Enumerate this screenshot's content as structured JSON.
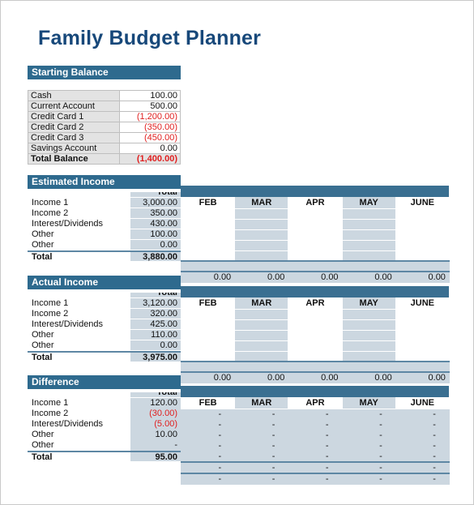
{
  "document": {
    "title": "Family Budget Planner"
  },
  "months": [
    "FEB",
    "MAR",
    "APR",
    "MAY",
    "JUNE"
  ],
  "starting_balance": {
    "heading": "Starting Balance",
    "rows": [
      {
        "label": "Cash",
        "value": "100.00",
        "negative": false
      },
      {
        "label": "Current Account",
        "value": "500.00",
        "negative": false
      },
      {
        "label": "Credit Card 1",
        "value": "(1,200.00)",
        "negative": true
      },
      {
        "label": "Credit Card 2",
        "value": "(350.00)",
        "negative": true
      },
      {
        "label": "Credit Card 3",
        "value": "(450.00)",
        "negative": true
      },
      {
        "label": "Savings Account",
        "value": "0.00",
        "negative": false
      }
    ],
    "total": {
      "label": "Total Balance",
      "value": "(1,400.00)",
      "negative": true
    }
  },
  "estimated_income": {
    "heading": "Estimated Income",
    "total_column_caption": "Total",
    "rows": [
      {
        "label": "Income 1",
        "total": "3,000.00",
        "negative": false,
        "months": [
          "",
          "",
          "",
          "",
          ""
        ]
      },
      {
        "label": "Income 2",
        "total": "350.00",
        "negative": false,
        "months": [
          "",
          "",
          "",
          "",
          ""
        ]
      },
      {
        "label": "Interest/Dividends",
        "total": "430.00",
        "negative": false,
        "months": [
          "",
          "",
          "",
          "",
          ""
        ]
      },
      {
        "label": "Other",
        "total": "100.00",
        "negative": false,
        "months": [
          "",
          "",
          "",
          "",
          ""
        ]
      },
      {
        "label": "Other",
        "total": "0.00",
        "negative": false,
        "months": [
          "",
          "",
          "",
          "",
          ""
        ]
      }
    ],
    "total_row": {
      "label": "Total",
      "total": "3,880.00",
      "negative": false,
      "months": [
        "",
        "",
        "",
        "",
        ""
      ]
    },
    "grand_row": {
      "months": [
        "0.00",
        "0.00",
        "0.00",
        "0.00",
        "0.00"
      ]
    }
  },
  "actual_income": {
    "heading": "Actual Income",
    "total_column_caption": "Total",
    "rows": [
      {
        "label": "Income 1",
        "total": "3,120.00",
        "negative": false,
        "months": [
          "",
          "",
          "",
          "",
          ""
        ]
      },
      {
        "label": "Income 2",
        "total": "320.00",
        "negative": false,
        "months": [
          "",
          "",
          "",
          "",
          ""
        ]
      },
      {
        "label": "Interest/Dividends",
        "total": "425.00",
        "negative": false,
        "months": [
          "",
          "",
          "",
          "",
          ""
        ]
      },
      {
        "label": "Other",
        "total": "110.00",
        "negative": false,
        "months": [
          "",
          "",
          "",
          "",
          ""
        ]
      },
      {
        "label": "Other",
        "total": "0.00",
        "negative": false,
        "months": [
          "",
          "",
          "",
          "",
          ""
        ]
      }
    ],
    "total_row": {
      "label": "Total",
      "total": "3,975.00",
      "negative": false,
      "months": [
        "",
        "",
        "",
        "",
        ""
      ]
    },
    "grand_row": {
      "months": [
        "0.00",
        "0.00",
        "0.00",
        "0.00",
        "0.00"
      ]
    }
  },
  "difference": {
    "heading": "Difference",
    "total_column_caption": "Total",
    "rows": [
      {
        "label": "Income 1",
        "total": "120.00",
        "negative": false,
        "months": [
          "-",
          "-",
          "-",
          "-",
          "-"
        ]
      },
      {
        "label": "Income 2",
        "total": "(30.00)",
        "negative": true,
        "months": [
          "-",
          "-",
          "-",
          "-",
          "-"
        ]
      },
      {
        "label": "Interest/Dividends",
        "total": "(5.00)",
        "negative": true,
        "months": [
          "-",
          "-",
          "-",
          "-",
          "-"
        ]
      },
      {
        "label": "Other",
        "total": "10.00",
        "negative": false,
        "months": [
          "-",
          "-",
          "-",
          "-",
          "-"
        ]
      },
      {
        "label": "Other",
        "total": "-",
        "negative": false,
        "months": [
          "-",
          "-",
          "-",
          "-",
          "-"
        ]
      }
    ],
    "total_row": {
      "label": "Total",
      "total": "95.00",
      "negative": false,
      "months": [
        "-",
        "-",
        "-",
        "-",
        "-"
      ]
    },
    "grand_row": {
      "months": [
        "-",
        "-",
        "-",
        "-",
        "-"
      ]
    }
  },
  "colors": {
    "title": "#17487a",
    "section_header_bg": "#2e6a8e",
    "month_bar_bg": "#3a6f91",
    "stripe_bg": "#ccd7e0",
    "negative_text": "#e02020",
    "rule": "#5e87a4"
  }
}
